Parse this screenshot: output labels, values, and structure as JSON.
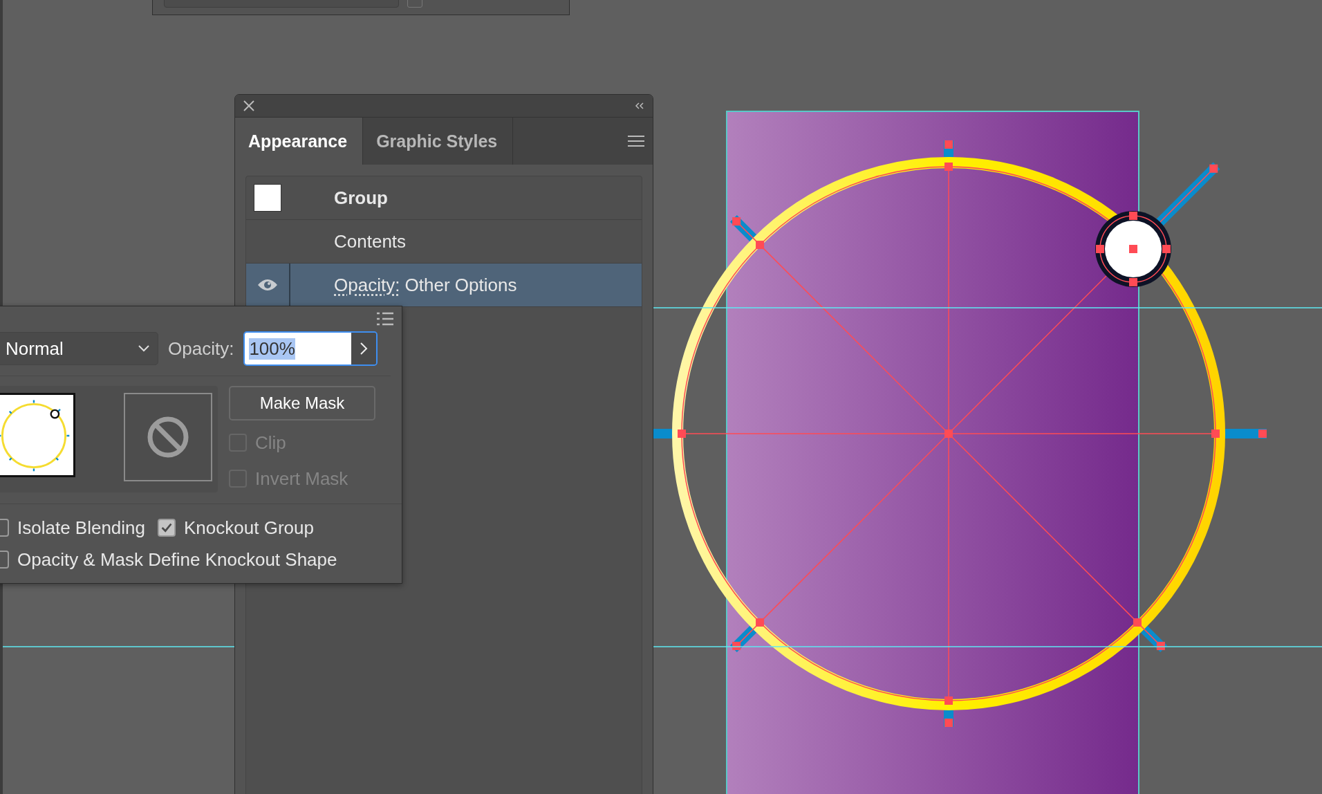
{
  "top_panel": {
    "checked": false
  },
  "appearance_panel": {
    "tabs": [
      {
        "label": "Appearance",
        "selected": true
      },
      {
        "label": "Graphic Styles",
        "selected": false
      }
    ],
    "rows": [
      {
        "kind": "swatch",
        "label": "Group",
        "selected": false
      },
      {
        "kind": "plain",
        "label": "Contents",
        "selected": false
      },
      {
        "kind": "attribute",
        "label": "Opacity:",
        "value": "Other Options",
        "visible": true,
        "selected": true
      }
    ]
  },
  "transparency_panel": {
    "blend_mode": "Normal",
    "opacity_label": "Opacity:",
    "opacity": "100%",
    "make_mask": "Make Mask",
    "mask_options": [
      {
        "label": "Clip",
        "checked": false,
        "disabled": true
      },
      {
        "label": "Invert Mask",
        "checked": false,
        "disabled": true
      }
    ],
    "options": [
      {
        "label": "Isolate Blending",
        "checked": false
      },
      {
        "label": "Knockout Group",
        "checked": true
      },
      {
        "label": "Opacity & Mask Define Knockout Shape",
        "checked": false
      }
    ]
  }
}
